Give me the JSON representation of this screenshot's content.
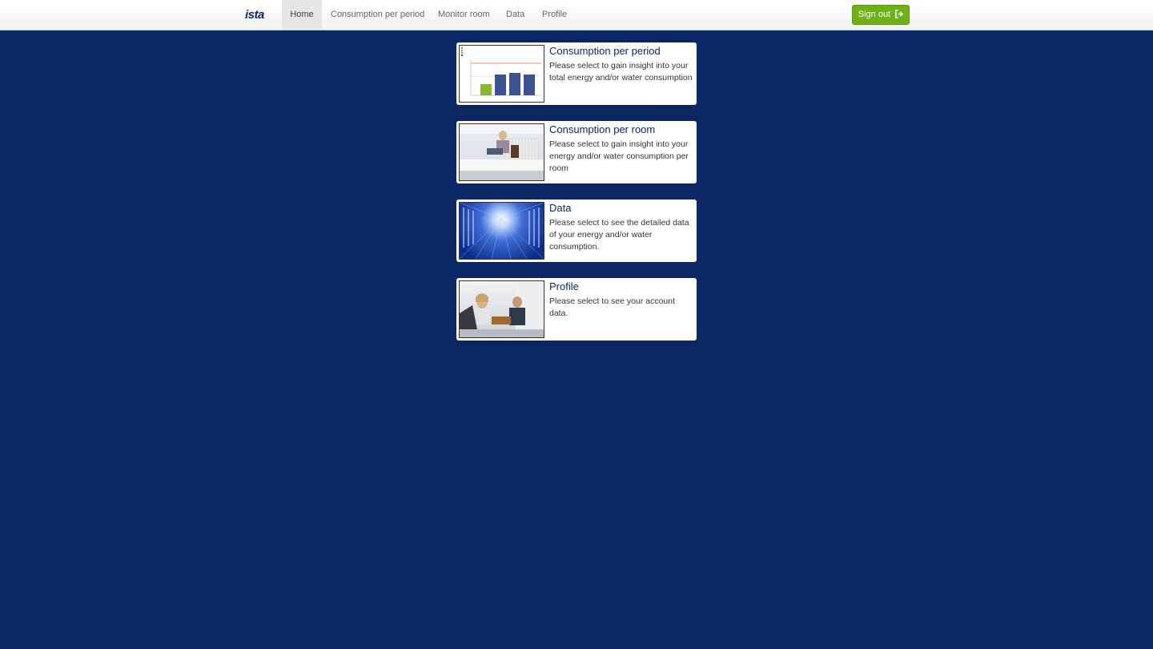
{
  "header": {
    "brand": "ista",
    "nav": [
      {
        "label": "Home",
        "active": true
      },
      {
        "label": "Consumption per period",
        "active": false
      },
      {
        "label": "Monitor room",
        "active": false
      },
      {
        "label": "Data",
        "active": false
      },
      {
        "label": "Profile",
        "active": false
      }
    ],
    "signout_label": "Sign out"
  },
  "cards": [
    {
      "title": "Consumption per period",
      "description": "Please select to gain insight into your total energy and/or water consumption"
    },
    {
      "title": "Consumption per room",
      "description": "Please select to gain insight into your energy and/or water consumption per room"
    },
    {
      "title": "Data",
      "description": "Please select to see the detailed data of your energy and/or water consumption."
    },
    {
      "title": "Profile",
      "description": "Please select to see your account data."
    }
  ],
  "colors": {
    "background": "#0b2865",
    "accent_green": "#6eb016",
    "title_blue": "#0b2865"
  }
}
